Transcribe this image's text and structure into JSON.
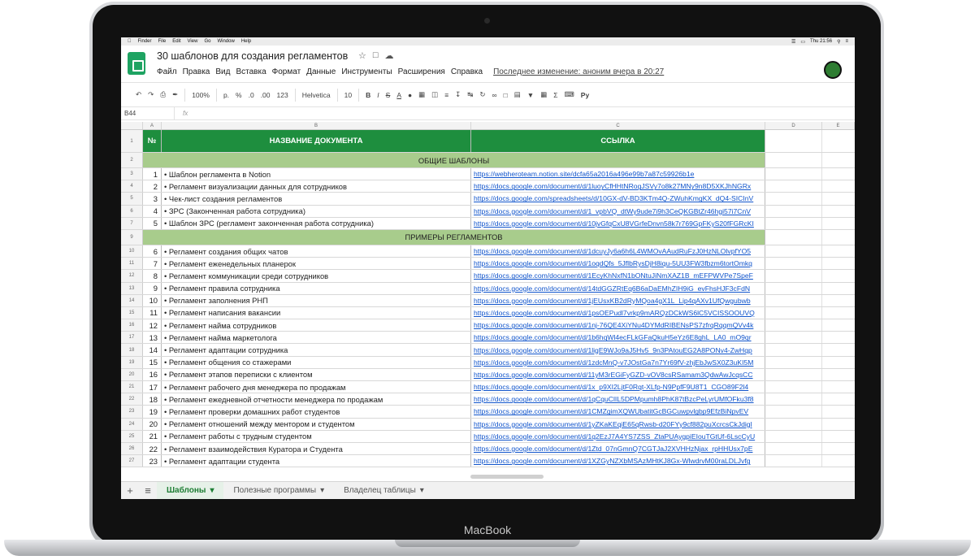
{
  "device": {
    "brand": "MacBook"
  },
  "macos_menu": {
    "items": [
      "Finder",
      "File",
      "Edit",
      "View",
      "Go",
      "Window",
      "Help"
    ],
    "clock": "Thu 21:56"
  },
  "doc": {
    "title": "30 шаблонов для создания регламентов",
    "menus": [
      "Файл",
      "Правка",
      "Вид",
      "Вставка",
      "Формат",
      "Данные",
      "Инструменты",
      "Расширения",
      "Справка"
    ],
    "last_edit": "Последнее изменение: аноним вчера в 20:27"
  },
  "toolbar": {
    "zoom": "100%",
    "currency": "р.",
    "percent": "%",
    "dec_less": ".0",
    "dec_more": ".00",
    "format_num": "123",
    "font": "Helvetica",
    "size": "10"
  },
  "formula": {
    "cell_ref": "B44",
    "fx": "fx"
  },
  "columns": [
    "A",
    "B",
    "C",
    "D",
    "E"
  ],
  "header": {
    "num": "№",
    "name": "НАЗВАНИЕ ДОКУМЕНТА",
    "link": "ССЫЛКА"
  },
  "sections": {
    "general": "ОБЩИЕ ШАБЛОНЫ",
    "examples": "ПРИМЕРЫ РЕГЛАМЕНТОВ"
  },
  "rows_general": [
    {
      "rn": "3",
      "n": "1",
      "name": "• Шаблон регламента в Notion",
      "link": "https://webheroteam.notion.site/dcfa65a2016a496e99b7a87c59926b1e"
    },
    {
      "rn": "4",
      "n": "2",
      "name": "• Регламент визуализации данных для сотрудников",
      "link": "https://docs.google.com/document/d/1luoyCfHHtNRogJSVy7o8k27MNy9n8D5XKJhNGRx"
    },
    {
      "rn": "5",
      "n": "3",
      "name": "• Чек-лист создания регламентов",
      "link": "https://docs.google.com/spreadsheets/d/10GX-dV-BD3KTm4Q-ZWuhKmgKX_dQ4-SICInV"
    },
    {
      "rn": "6",
      "n": "4",
      "name": "• ЗРС (Законченная работа сотрудника)",
      "link": "https://docs.google.com/document/d/1_vpbVQ_dtWy9ude7i9h3CeQKGBtZr46hgi57i7CnV"
    },
    {
      "rn": "7",
      "n": "5",
      "name": "• Шаблон ЗРС (регламент законченная работа сотрудника)",
      "link": "https://docs.google.com/document/d/10jvGfqCxU8VGrfeDnvn58k7r769GpFKyS20fFGRcKI"
    }
  ],
  "rows_examples": [
    {
      "rn": "10",
      "n": "6",
      "name": "• Регламент создания общих чатов",
      "link": "https://docs.google.com/document/d/1dcuyJy6a6h6L4WMOvAAudRuFzJ0HzNLOlvpfYO5"
    },
    {
      "rn": "11",
      "n": "7",
      "name": "• Регламент еженедельных планерок",
      "link": "https://docs.google.com/document/d/1oqdQfs_5JflbRysDjH8iqu-5UU3FW3fbzm6tortOmkq"
    },
    {
      "rn": "12",
      "n": "8",
      "name": "• Регламент коммуникации среди сотрудников",
      "link": "https://docs.google.com/document/d/1EcyKhNxfN1bONtuJiNmXAZ1B_mEFPWVPe7SpeF"
    },
    {
      "rn": "13",
      "n": "9",
      "name": "• Регламент правила сотрудника",
      "link": "https://docs.google.com/document/d/14tdGGZRtEq6B6aDaEMhZIH9iG_evFhsHJF3cFdN"
    },
    {
      "rn": "14",
      "n": "10",
      "name": "• Регламент заполнения РНП",
      "link": "https://docs.google.com/document/d/1jEUsxKB2dRyMQoa4gX1L_Lip4qAXv1UfQwgubwb"
    },
    {
      "rn": "15",
      "n": "11",
      "name": "• Регламент написания вакансии",
      "link": "https://docs.google.com/document/d/1psOEPudl7vrkp9mARQzDCkWS6lC5VCISSOOUVQ"
    },
    {
      "rn": "16",
      "n": "12",
      "name": "• Регламент найма сотрудников",
      "link": "https://docs.google.com/document/d/1nj-76QE4XiYNu4DYMdRIBENsPS7zfrqRqqmQVv4k"
    },
    {
      "rn": "17",
      "n": "13",
      "name": "• Регламент найма маркетолога",
      "link": "https://docs.google.com/document/d/1b6hqWl4ecFLkGFaQkuH5eYz6E8ghL_LA0_mO9qr"
    },
    {
      "rn": "18",
      "n": "14",
      "name": "• Регламент адаптации сотрудника",
      "link": "https://docs.google.com/document/d/1ligE9WJo9aJ5Hv5_9n3PAtouEG2A8PONv4-ZwHqp"
    },
    {
      "rn": "19",
      "n": "15",
      "name": "• Регламент общения со стажерами",
      "link": "https://docs.google.com/document/d/1zdcMnQ-v7JOstGa7n7Yr69fV-zhjEbJwSX0Z3uKI5M"
    },
    {
      "rn": "20",
      "n": "16",
      "name": "• Регламент этапов переписки с клиентом",
      "link": "https://docs.google.com/document/d/11yM3rEGiFyGZD-vOV8csRSamam3QdwAwJcqsCC"
    },
    {
      "rn": "21",
      "n": "17",
      "name": "• Регламент рабочего дня менеджера по продажам",
      "link": "https://docs.google.com/document/d/1x_p9XI2LjtF0Rqt-XLfp-N9PpfF9U8T1_CGO89F2l4"
    },
    {
      "rn": "22",
      "n": "18",
      "name": "• Регламент ежедневной отчетности менеджера по продажам",
      "link": "https://docs.google.com/document/d/1qCquClIL5DPMpumh8PhK87tBzcPeLyrUMfOFku3f8"
    },
    {
      "rn": "23",
      "n": "19",
      "name": "• Регламент проверки домашних работ студентов",
      "link": "https://docs.google.com/document/d/1CMZgimXQWUbatitGcBGCuwpvlgbp9EfzBiNpvEV"
    },
    {
      "rn": "24",
      "n": "20",
      "name": "• Регламент отношений между ментором и студентом",
      "link": "https://docs.google.com/document/d/1yZKaKEqiE65qRwsb-d20FYy9cf882puXcrcsCkJdigl"
    },
    {
      "rn": "25",
      "n": "21",
      "name": "• Регламент работы с трудным студентом",
      "link": "https://docs.google.com/document/d/1q2EzJ7A4YS7ZSS_ZtaPUAygpiEIouTGtUf-6LscCyU"
    },
    {
      "rn": "26",
      "n": "22",
      "name": "• Регламент взаимодействия Куратора и Студента",
      "link": "https://docs.google.com/document/d/1Ztd_07nGmnQ7CGTJaJ2XVHHzNjax_rpHHUsx7pE"
    },
    {
      "rn": "27",
      "n": "23",
      "name": "• Регламент адаптации студента",
      "link": "https://docs.google.com/document/d/1XZGyNZXbMSAzMHtKJ8Gx-WlwdrvM00raLDLJvfg"
    }
  ],
  "sheet_tabs": [
    "Шаблоны",
    "Полезные программы",
    "Владелец таблицы"
  ]
}
